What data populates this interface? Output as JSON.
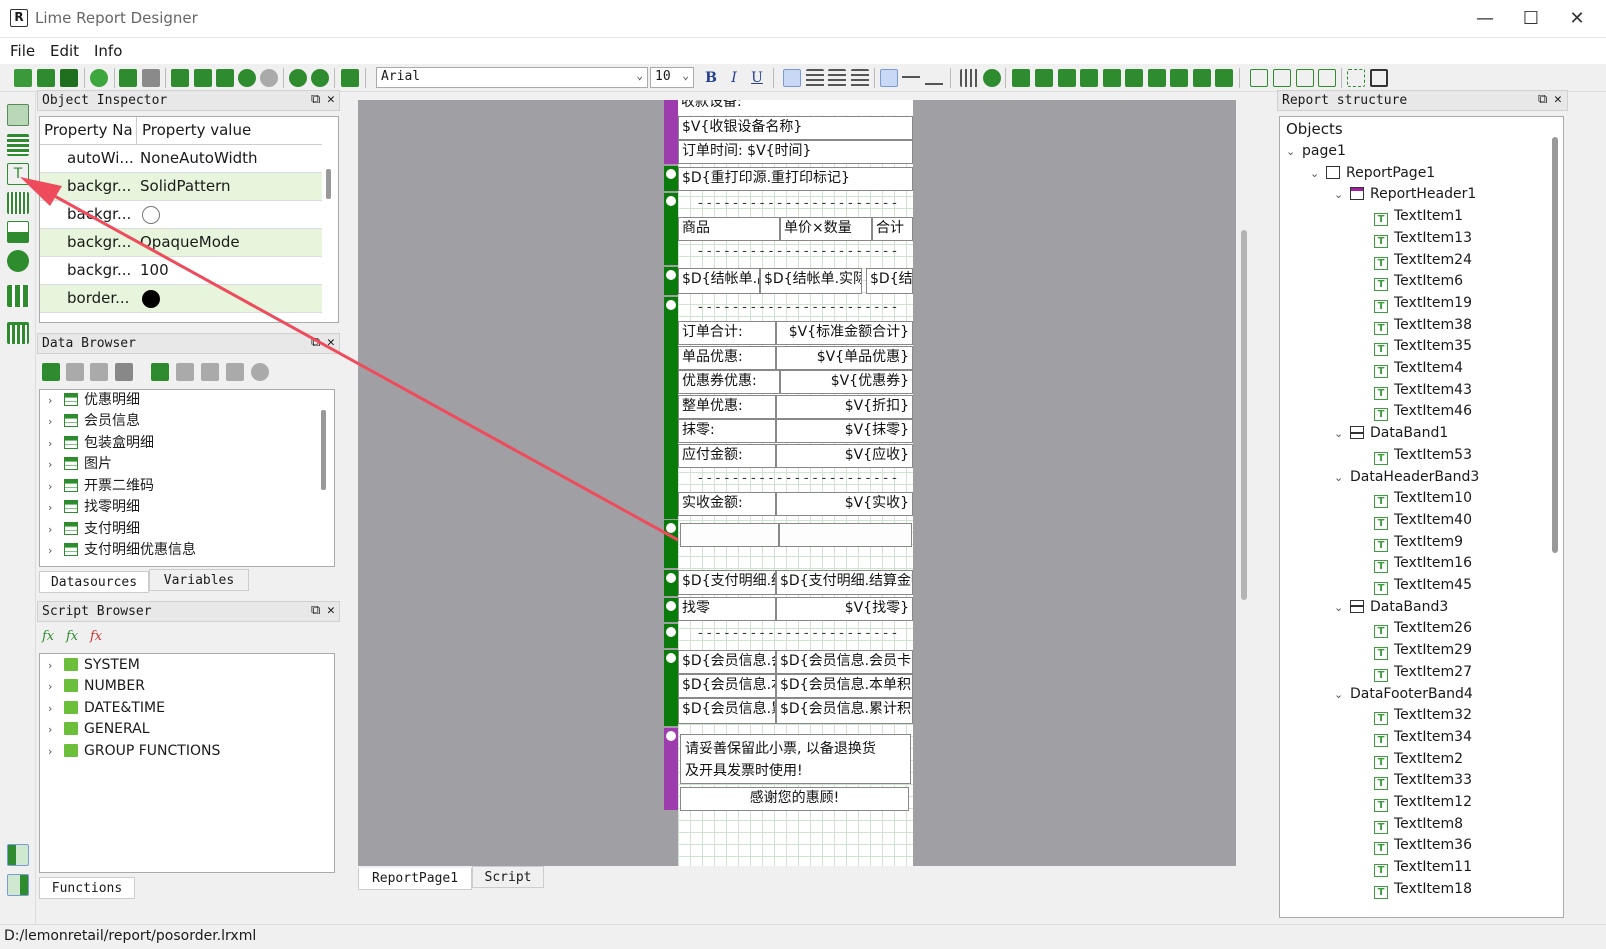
{
  "window": {
    "title": "Lime Report Designer",
    "app_icon": "R",
    "minimize": "—",
    "maximize": "☐",
    "close": "✕"
  },
  "menu": [
    "File",
    "Edit",
    "Info"
  ],
  "toolbar": {
    "font_name": "Arial",
    "font_size": "10",
    "bold": "B",
    "italic": "I",
    "underline": "U"
  },
  "object_inspector": {
    "title": "Object Inspector",
    "headers": {
      "name": "Property Na",
      "value": "Property value"
    },
    "rows": [
      {
        "name": "autoWi...",
        "value": "NoneAutoWidth"
      },
      {
        "name": "backgr...",
        "value": "SolidPattern"
      },
      {
        "name": "backgr...",
        "value": ""
      },
      {
        "name": "backgr...",
        "value": "OpaqueMode"
      },
      {
        "name": "backgr...",
        "value": "100"
      },
      {
        "name": "border...",
        "value": ""
      }
    ]
  },
  "data_browser": {
    "title": "Data Browser",
    "items": [
      "优惠明细",
      "会员信息",
      "包装盒明细",
      "图片",
      "开票二维码",
      "找零明细",
      "支付明细",
      "支付明细优惠信息"
    ],
    "tabs": [
      "Datasources",
      "Variables"
    ]
  },
  "script_browser": {
    "title": "Script Browser",
    "items": [
      "SYSTEM",
      "NUMBER",
      "DATE&TIME",
      "GENERAL",
      "GROUP FUNCTIONS"
    ],
    "tab": "Functions"
  },
  "report": {
    "texts": {
      "t_cut": "收款设备:",
      "t1": "$V{收银设备名称}",
      "t2": "订单时间: $V{时间}",
      "t3": "$D{重打印源.重打印标记}",
      "dash1": "- - - - - - - - - - - - - - - - - - - - - - - -",
      "h1": "商品",
      "h2": "单价×数量",
      "h3": "合计",
      "dash2": "- - - - - - - - - - - - - - - - - - - - - - - -",
      "d1": "$D{结帐单.品名}",
      "d2": "$D{结帐单.实际单价}×",
      "d3": "$D{结帐",
      "dash3": "- - - - - - - - - - - - - - - - - - - - - - - -",
      "s1l": "订单合计:",
      "s1r": "$V{标准金额合计}",
      "s2l": "单品优惠:",
      "s2r": "$V{单品优惠}",
      "s3l": "优惠券优惠:",
      "s3r": "$V{优惠券}",
      "s4l": "整单优惠:",
      "s4r": "$V{折扣}",
      "s5l": "抹零:",
      "s5r": "$V{抹零}",
      "s6l": "应付金额:",
      "s6r": "$V{应收}",
      "dash4": "- - - - - - - - - - - - - - - - - - - - - - - -",
      "s7l": "实收金额:",
      "s7r": "$V{实收}",
      "p1": "$D{支付明细.结算方",
      "p2": "$D{支付明细.结算金额}",
      "z1": "找零",
      "z2": "$V{找零}",
      "dash5": "- - - - - - - - - - - - - - - - - - - - - - - -",
      "m1l": "$D{会员信息.会员卡号}",
      "m1r": "$D{会员信息.会员卡号}",
      "m2l": "$D{会员信息.本单积分}",
      "m2r": "$D{会员信息.本单积分}",
      "m3l": "$D{会员信息.累计积分}",
      "m3r": "$D{会员信息.累计积分}",
      "f1": "请妥善保留此小票, 以备退换货",
      "f2": "及开具发票时使用!",
      "f3": "感谢您的惠顾!"
    },
    "tabs": [
      "ReportPage1",
      "Script"
    ]
  },
  "report_structure": {
    "title": "Report structure",
    "root": "Objects",
    "nodes": [
      {
        "label": "page1",
        "level": 0,
        "kind": "chev"
      },
      {
        "label": "ReportPage1",
        "level": 1,
        "kind": "page"
      },
      {
        "label": "ReportHeader1",
        "level": 2,
        "kind": "rh"
      },
      {
        "label": "TextItem1",
        "level": 3,
        "kind": "text"
      },
      {
        "label": "TextItem13",
        "level": 3,
        "kind": "text"
      },
      {
        "label": "TextItem24",
        "level": 3,
        "kind": "text"
      },
      {
        "label": "TextItem6",
        "level": 3,
        "kind": "text"
      },
      {
        "label": "TextItem19",
        "level": 3,
        "kind": "text"
      },
      {
        "label": "TextItem38",
        "level": 3,
        "kind": "text"
      },
      {
        "label": "TextItem35",
        "level": 3,
        "kind": "text"
      },
      {
        "label": "TextItem4",
        "level": 3,
        "kind": "text"
      },
      {
        "label": "TextItem43",
        "level": 3,
        "kind": "text"
      },
      {
        "label": "TextItem46",
        "level": 3,
        "kind": "text"
      },
      {
        "label": "DataBand1",
        "level": 2,
        "kind": "band"
      },
      {
        "label": "TextItem53",
        "level": 3,
        "kind": "text"
      },
      {
        "label": "DataHeaderBand3",
        "level": 2,
        "kind": "none"
      },
      {
        "label": "TextItem10",
        "level": 3,
        "kind": "text"
      },
      {
        "label": "TextItem40",
        "level": 3,
        "kind": "text"
      },
      {
        "label": "TextItem9",
        "level": 3,
        "kind": "text"
      },
      {
        "label": "TextItem16",
        "level": 3,
        "kind": "text"
      },
      {
        "label": "TextItem45",
        "level": 3,
        "kind": "text"
      },
      {
        "label": "DataBand3",
        "level": 2,
        "kind": "band"
      },
      {
        "label": "TextItem26",
        "level": 3,
        "kind": "text"
      },
      {
        "label": "TextItem29",
        "level": 3,
        "kind": "text"
      },
      {
        "label": "TextItem27",
        "level": 3,
        "kind": "text"
      },
      {
        "label": "DataFooterBand4",
        "level": 2,
        "kind": "none"
      },
      {
        "label": "TextItem32",
        "level": 3,
        "kind": "text"
      },
      {
        "label": "TextItem34",
        "level": 3,
        "kind": "text"
      },
      {
        "label": "TextItem2",
        "level": 3,
        "kind": "text"
      },
      {
        "label": "TextItem33",
        "level": 3,
        "kind": "text"
      },
      {
        "label": "TextItem12",
        "level": 3,
        "kind": "text"
      },
      {
        "label": "TextItem8",
        "level": 3,
        "kind": "text"
      },
      {
        "label": "TextItem36",
        "level": 3,
        "kind": "text"
      },
      {
        "label": "TextItem11",
        "level": 3,
        "kind": "text"
      },
      {
        "label": "TextItem18",
        "level": 3,
        "kind": "text"
      }
    ]
  },
  "status_bar": {
    "path": "D:/lemonretail/report/posorder.lrxml"
  },
  "colors": {
    "band_green": "#0a7a0a",
    "band_purple": "#9c3cad",
    "arrow": "#ee4b5c"
  }
}
